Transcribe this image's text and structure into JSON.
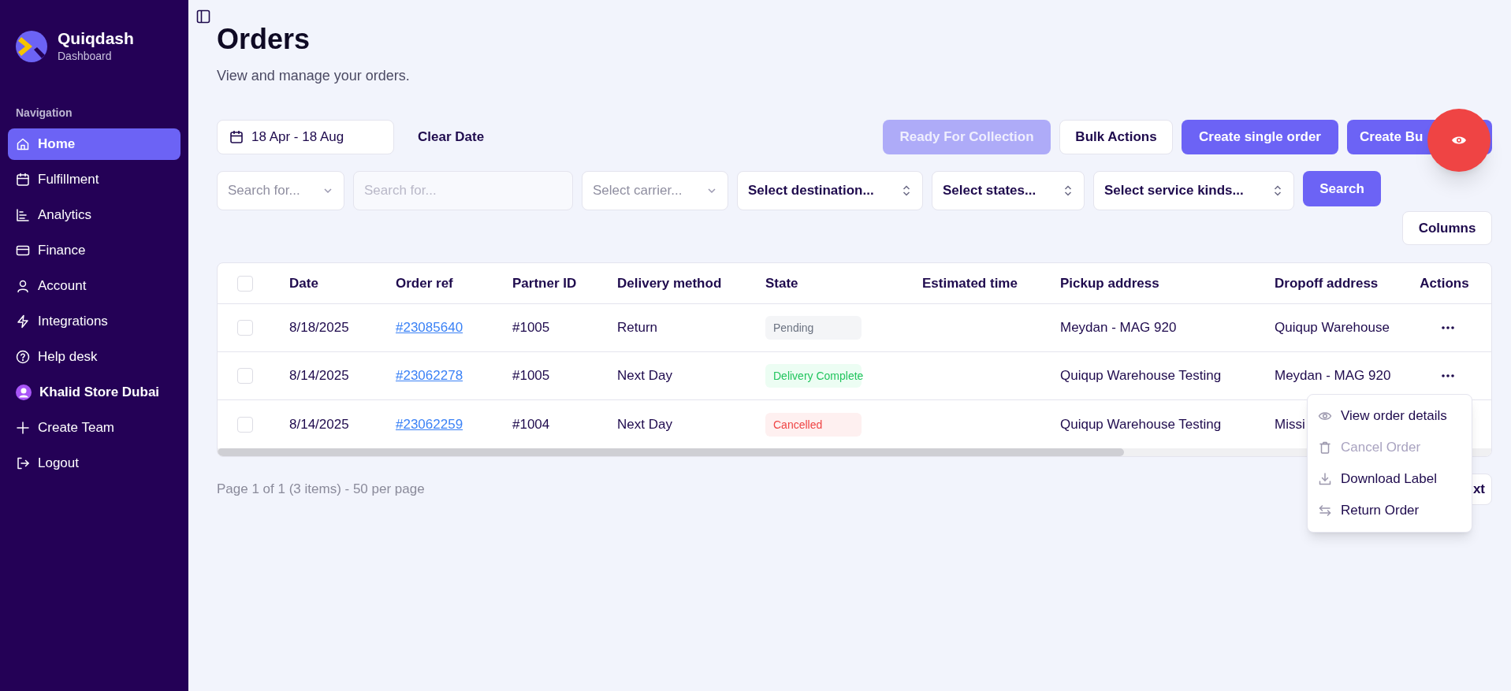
{
  "sidebar": {
    "brand": "Quiqdash",
    "subtitle": "Dashboard",
    "section": "Navigation",
    "items": [
      {
        "label": "Home",
        "kind": "link",
        "selected": true
      },
      {
        "label": "Fulfillment",
        "kind": "link",
        "selected": false
      },
      {
        "label": "Analytics",
        "kind": "link",
        "selected": false
      },
      {
        "label": "Finance",
        "kind": "link",
        "selected": false
      },
      {
        "label": "Account",
        "kind": "link",
        "selected": false
      },
      {
        "label": "Integrations",
        "kind": "link",
        "selected": false
      },
      {
        "label": "Help desk",
        "kind": "link",
        "selected": false
      },
      {
        "label": "Khalid Store Dubai",
        "kind": "team",
        "selected": false
      },
      {
        "label": "Create Team",
        "kind": "link",
        "selected": false
      },
      {
        "label": "Logout",
        "kind": "link",
        "selected": false
      }
    ]
  },
  "page": {
    "title": "Orders",
    "subtitle": "View and manage your orders."
  },
  "toolbar": {
    "date_range": "18 Apr - 18 Aug",
    "clear": "Clear Date",
    "buttons": [
      {
        "label": "Ready For Collection",
        "kind": "primary",
        "disabled": true
      },
      {
        "label": "Bulk Actions",
        "kind": "outline",
        "disabled": false
      },
      {
        "label": "Create single order",
        "kind": "primary",
        "disabled": false
      },
      {
        "label": "Create Bu",
        "kind": "primary",
        "disabled": false
      }
    ]
  },
  "filters": [
    {
      "kind": "dropdown",
      "placeholder": "Search for..."
    },
    {
      "kind": "input",
      "placeholder": "Search for..."
    },
    {
      "kind": "dropdown",
      "placeholder": "Select carrier..."
    },
    {
      "kind": "select",
      "value": "Select destination..."
    },
    {
      "kind": "select",
      "value": "Select states..."
    },
    {
      "kind": "select",
      "value": "Select service kinds..."
    }
  ],
  "search_button": "Search",
  "columns_button": "Columns",
  "table": {
    "columns": [
      "Date",
      "Order ref",
      "Partner ID",
      "Delivery method",
      "State",
      "Estimated time",
      "Pickup address",
      "Dropoff address",
      "Actions"
    ],
    "header_checked": false,
    "rows": [
      {
        "checked": false,
        "date": "8/18/2025",
        "order_ref": "#23085640",
        "partner_id": "#1005",
        "delivery_method": "Return",
        "state": {
          "label": "Pending",
          "kind": "neutral"
        },
        "pickup": "Meydan - MAG 920",
        "dropoff": "Quiqup Warehouse"
      },
      {
        "checked": false,
        "date": "8/14/2025",
        "order_ref": "#23062278",
        "partner_id": "#1005",
        "delivery_method": "Next Day",
        "state": {
          "label": "Delivery Complete",
          "kind": "success"
        },
        "pickup": "Quiqup Warehouse Testing",
        "dropoff": "Meydan - MAG 920"
      },
      {
        "checked": false,
        "date": "8/14/2025",
        "order_ref": "#23062259",
        "partner_id": "#1004",
        "delivery_method": "Next Day",
        "state": {
          "label": "Cancelled",
          "kind": "danger"
        },
        "pickup": "Quiqup Warehouse Testing",
        "dropoff": "Missi"
      }
    ]
  },
  "pagination": {
    "summary": "Page 1 of 1 (3 items) - 50 per page",
    "next": "xt"
  },
  "action_menu": {
    "items": [
      {
        "label": "View order details",
        "disabled": false
      },
      {
        "label": "Cancel Order",
        "disabled": true
      },
      {
        "label": "Download Label",
        "disabled": false
      },
      {
        "label": "Return Order",
        "disabled": false
      }
    ]
  }
}
